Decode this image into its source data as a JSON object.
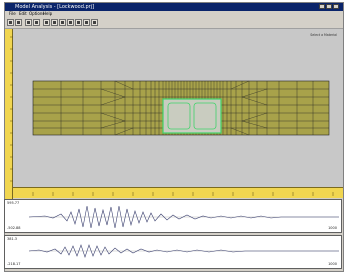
{
  "window": {
    "title": "Model Analysis - [Lockwood.prj]"
  },
  "menu": {
    "items": [
      "File",
      "Edit",
      "Options",
      "Help"
    ]
  },
  "toolbar": {
    "buttons": [
      "zoom-in",
      "zoom-out",
      "pan",
      "select",
      "node",
      "element",
      "material",
      "boundary",
      "load",
      "run",
      "results"
    ]
  },
  "viewport": {
    "corner_label": "Select a Material",
    "model_fill": "#a8a24a",
    "inclusion_fill": "#c9ccc0",
    "inclusion_outline": "#3fd36a",
    "mesh_line": "#222222"
  },
  "traces": [
    {
      "top_label": "595.77",
      "bottom_label": "-502.88",
      "end_label": "1000",
      "color": "#3a3f6e"
    },
    {
      "top_label": "381.3",
      "bottom_label": "-218.17",
      "end_label": "1000",
      "color": "#3a3f6e"
    }
  ]
}
